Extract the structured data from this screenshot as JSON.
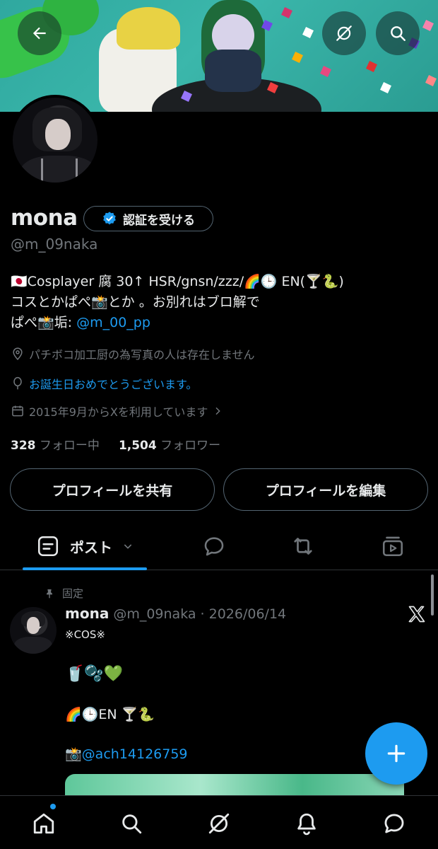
{
  "profile": {
    "name": "mona",
    "verify_label": "認証を受ける",
    "handle": "@m_09naka",
    "bio_line1": "🇯🇵Cosplayer 腐 30↑ HSR/gnsn/zzz/🌈🕒 EN(🍸🐍)",
    "bio_line2": "コスとかぱぺ📸とか 。お別れはブロ解で",
    "bio_line3_prefix": "ぱぺ📸垢: ",
    "bio_line3_link": "@m_00_pp",
    "location": "パチボコ加工厨の為写真の人は存在しません",
    "birthday": "お誕生日おめでとうございます。",
    "joined": "2015年9月からXを利用しています",
    "following_count": "328",
    "following_label": "フォロー中",
    "followers_count": "1,504",
    "followers_label": "フォロワー",
    "share_button": "プロフィールを共有",
    "edit_button": "プロフィールを編集"
  },
  "tabs": {
    "posts_label": "ポスト"
  },
  "post": {
    "pinned_label": "固定",
    "name": "mona",
    "meta": "@m_09naka · 2026/06/14",
    "line1": "※COS※",
    "line2": "🥤🫧💚",
    "line3": "🌈🕒EN 🍸🐍",
    "line4_prefix": "📸",
    "line4_link": "@ach14126759"
  },
  "colors": {
    "accent": "#1d9bf0",
    "background": "#000000",
    "secondary_text": "#71767b",
    "border": "#536471"
  },
  "icons": {
    "back": "arrow-left-icon",
    "grok": "grok-icon",
    "search": "search-icon",
    "verified": "verified-badge-icon",
    "location": "location-pin-icon",
    "balloon": "balloon-icon",
    "calendar": "calendar-icon",
    "pin": "pin-icon",
    "x_logo": "x-logo-icon",
    "compose": "plus-icon"
  }
}
